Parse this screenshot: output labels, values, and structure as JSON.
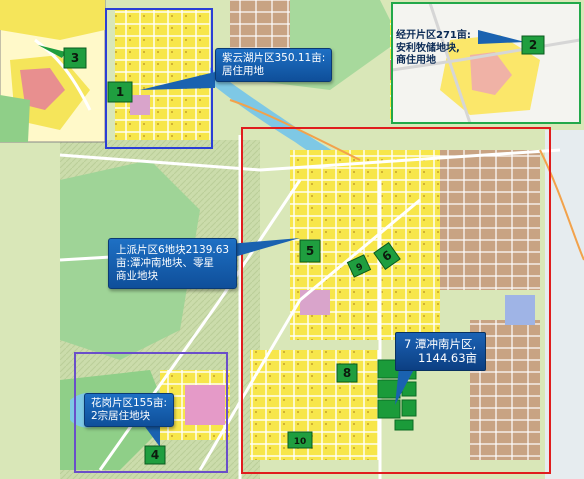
{
  "zones": [
    {
      "id": "zone-1",
      "number": "1",
      "text_lines": [
        "紫云湖片区350.11亩:",
        "居住用地"
      ]
    },
    {
      "id": "zone-2",
      "number": "2",
      "text_lines": [
        "经开片区271亩:",
        "安利牧储地块,",
        "商住用地"
      ]
    },
    {
      "id": "zone-3",
      "number": "3",
      "text_lines": []
    },
    {
      "id": "zone-4",
      "number": "4",
      "text_lines": [
        "花岗片区155亩:",
        "2宗居住地块"
      ]
    },
    {
      "id": "zone-5",
      "number": "5",
      "text_lines": [
        "上派片区6地块2139.63",
        "亩:潭冲南地块、零星",
        "商业地块"
      ]
    },
    {
      "id": "zone-6",
      "number": "6",
      "text_lines": []
    },
    {
      "id": "zone-7",
      "number": "7",
      "text_lines": [
        "7 潭冲南片区,",
        "1144.63亩"
      ]
    },
    {
      "id": "zone-8",
      "number": "8",
      "text_lines": []
    },
    {
      "id": "zone-9",
      "number": "9",
      "text_lines": []
    },
    {
      "id": "zone-10",
      "number": "10",
      "text_lines": []
    }
  ],
  "colors": {
    "frame_blue": "#2b3fd6",
    "frame_green": "#22a84a",
    "frame_red": "#e01d1d",
    "frame_purple": "#6a4fc9",
    "marker_green": "#1f9e3f",
    "residential": "#ffe34d",
    "commercial": "#d6a6c8",
    "industrial": "#a57a66",
    "green_space": "#8fd18a",
    "water": "#7fc9e6"
  }
}
